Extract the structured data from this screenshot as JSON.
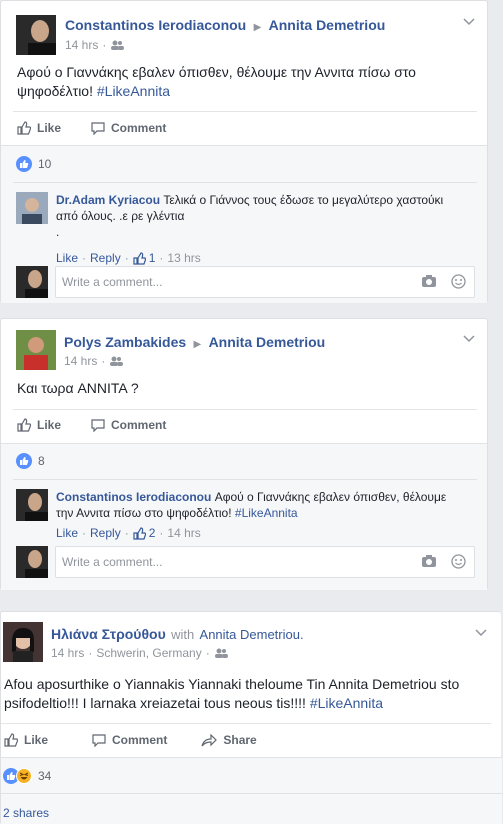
{
  "post1": {
    "author": "Constantinos Ierodiaconou",
    "target": "Annita Demetriou",
    "time": "14 hrs",
    "text": "Αφού ο Γιαννάκης εβαλεν όπισθεν, θέλουμε την Αννιτα πίσω στο ψηφοδέλτιο! ",
    "hashtag": "#LikeAnnita",
    "like_label": "Like",
    "comment_label": "Comment",
    "likes": "10",
    "reply": {
      "author": "Dr.Adam Kyriacou",
      "text": "Τελικά ο Γιάννος τους έδωσε το μεγαλύτερο χαστούκι από όλους. .ε ρε γλέντια",
      "extra": ".",
      "like": "Like",
      "reply": "Reply",
      "likes": "1",
      "time": "13 hrs"
    },
    "input_placeholder": "Write a comment..."
  },
  "post2": {
    "author": "Polys Zambakides",
    "target": "Annita Demetriou",
    "time": "14 hrs",
    "text": "Και τωρα ANNITA ?",
    "like_label": "Like",
    "comment_label": "Comment",
    "likes": "8",
    "reply": {
      "author": "Constantinos Ierodiaconou",
      "text": "Αφού ο Γιαννάκης εβαλεν όπισθεν, θέλουμε την Αννιτα πίσω στο ψηφοδέλτιο! ",
      "hashtag": "#LikeAnnita",
      "like": "Like",
      "reply": "Reply",
      "likes": "2",
      "time": "14 hrs"
    },
    "input_placeholder": "Write a comment..."
  },
  "post3": {
    "author": "Ηλιάνα Στρούθου",
    "with_text": "with",
    "target": "Annita Demetriou.",
    "time": "14 hrs",
    "location": "Schwerin, Germany",
    "text": "Afou aposurthike o Yiannakis Yiannaki theloume Tin Annita Demetriou sto psifodeltio!!! I larnaka xreiazetai tous neous tis!!!! ",
    "hashtag": "#LikeAnnita",
    "like_label": "Like",
    "comment_label": "Comment",
    "share_label": "Share",
    "reactions": "34",
    "shares": "2 shares"
  },
  "colors": {
    "link": "#365899",
    "like_blue": "#5890ff",
    "haha_yellow": "#f7b125"
  }
}
